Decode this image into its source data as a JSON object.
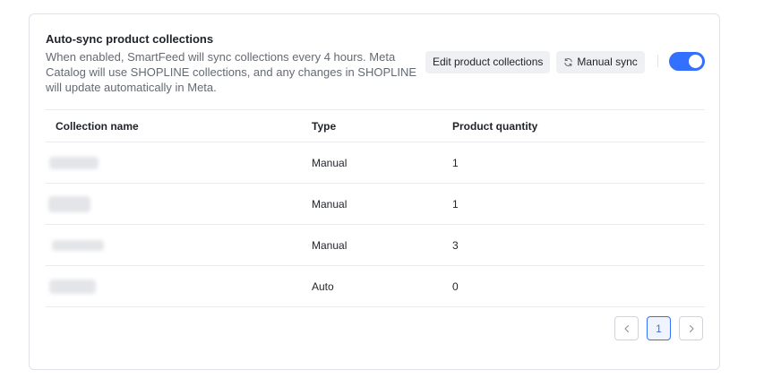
{
  "section": {
    "title": "Auto-sync product collections",
    "description": "When enabled, SmartFeed will sync collections every 4 hours. Meta Catalog will use SHOPLINE collections, and any changes in SHOPLINE will update automatically in Meta.",
    "edit_button_label": "Edit product collections",
    "manual_sync_label": "Manual sync",
    "auto_sync_enabled": true
  },
  "table": {
    "columns": [
      "Collection name",
      "Type",
      "Product quantity"
    ],
    "rows": [
      {
        "name": "",
        "type": "Manual",
        "quantity": "1"
      },
      {
        "name": "",
        "type": "Manual",
        "quantity": "1"
      },
      {
        "name": "",
        "type": "Manual",
        "quantity": "3"
      },
      {
        "name": "",
        "type": "Auto",
        "quantity": "0"
      }
    ]
  },
  "pagination": {
    "current_page": "1"
  },
  "colors": {
    "accent": "#3370ff",
    "border": "#dfe2e7",
    "muted_text": "#646a73"
  },
  "icons": {
    "sync": "sync-icon",
    "prev": "chevron-left-icon",
    "next": "chevron-right-icon"
  }
}
